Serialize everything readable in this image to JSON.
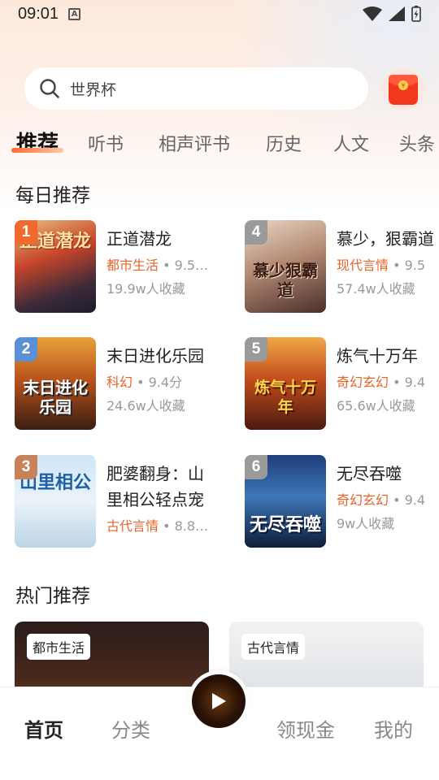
{
  "status": {
    "time": "09:01"
  },
  "search": {
    "placeholder": "世界杯"
  },
  "tabs": [
    "推荐",
    "听书",
    "相声评书",
    "历史",
    "人文",
    "头条"
  ],
  "daily": {
    "title": "每日推荐",
    "books": [
      {
        "rank": "1",
        "title": "正道潜龙",
        "category": "都市生活",
        "score": "9.5…",
        "fav": "19.9w人收藏",
        "cover_text": "正道潜龙"
      },
      {
        "rank": "2",
        "title": "末日进化乐园",
        "category": "科幻",
        "score": "9.4分",
        "fav": "24.6w人收藏",
        "cover_text": "末日进化乐园"
      },
      {
        "rank": "3",
        "title": "肥婆翻身：山里相公轻点宠",
        "category": "古代言情",
        "score": "8.8…",
        "fav": "",
        "cover_text": "山里相公"
      },
      {
        "rank": "4",
        "title": "慕少，狠霸道",
        "category": "现代言情",
        "score": "9.5",
        "fav": "57.4w人收藏",
        "cover_text": "慕少狠霸道"
      },
      {
        "rank": "5",
        "title": "炼气十万年",
        "category": "奇幻玄幻",
        "score": "9.4",
        "fav": "65.6w人收藏",
        "cover_text": "炼气十万年"
      },
      {
        "rank": "6",
        "title": "无尽吞噬",
        "category": "奇幻玄幻",
        "score": "9.4",
        "fav": "9w人收藏",
        "cover_text": "无尽吞噬"
      }
    ]
  },
  "hot": {
    "title": "热门推荐",
    "cards": [
      {
        "tag": "都市生活"
      },
      {
        "tag": "古代言情"
      }
    ]
  },
  "nav": {
    "home": "首页",
    "category": "分类",
    "reward": "领现金",
    "mine": "我的"
  },
  "colors": {
    "accent": "#e8632a",
    "rank1": "#f06a2e",
    "rank2": "#5b8fd6",
    "rank3": "#c8825a",
    "rank_other": "#9a9a9a"
  }
}
